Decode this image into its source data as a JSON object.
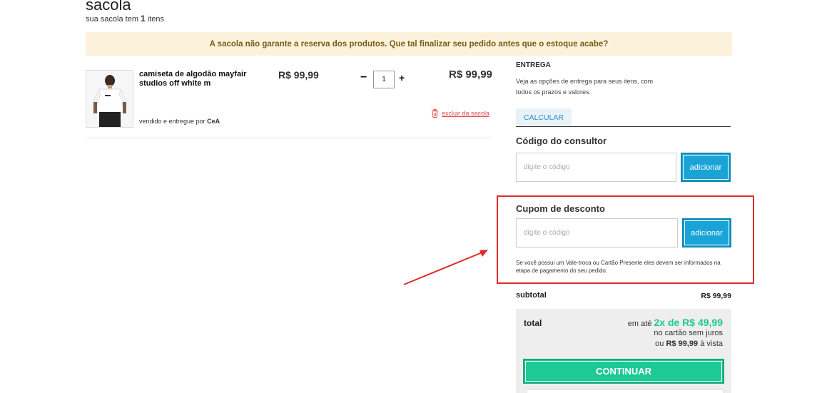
{
  "header": {
    "title": "sacola",
    "subtitle_prefix": "sua sacola tem",
    "item_count": "1",
    "subtitle_suffix": "itens"
  },
  "banner": {
    "text": "A sacola não garante a reserva dos produtos. Que tal finalizar seu pedido antes que o estoque acabe?"
  },
  "cart": {
    "item": {
      "name": "camiseta de algodão mayfair studios off white m",
      "unit_price": "R$ 99,99",
      "quantity": "1",
      "minus_label": "−",
      "plus_label": "+",
      "line_total": "R$ 99,99",
      "seller_prefix": "vendido e entregue por",
      "seller": "CeA",
      "remove_label": "excluir da sacola"
    }
  },
  "delivery": {
    "title": "ENTREGA",
    "description": "Veja as opções de entrega para seus itens, com todos os prazos e valores.",
    "calc_label": "CALCULAR"
  },
  "consultant": {
    "title": "Código do consultor",
    "placeholder": "digite o código",
    "button_label": "adicionar"
  },
  "coupon": {
    "title": "Cupom de desconto",
    "placeholder": "digite o código",
    "button_label": "adicionar",
    "note": "Se você possui um Vale-troca ou Cartão Presente eles devem ser informados na etapa de pagamento do seu pedido."
  },
  "summary": {
    "subtotal_label": "subtotal",
    "subtotal_value": "R$ 99,99",
    "total_label": "total",
    "installment_prefix": "em até",
    "installment_value": "2x de R$ 49,99",
    "installment_note": "no cartão sem juros",
    "cash_prefix": "ou",
    "cash_value": "R$ 99,99",
    "cash_suffix": "à vista",
    "continue_label": "CONTINUAR"
  },
  "colors": {
    "accent_blue": "#1aa3d6",
    "continue_green": "#1ec995",
    "highlight_red": "#e02a2a",
    "banner_bg": "#fcf2dc"
  }
}
